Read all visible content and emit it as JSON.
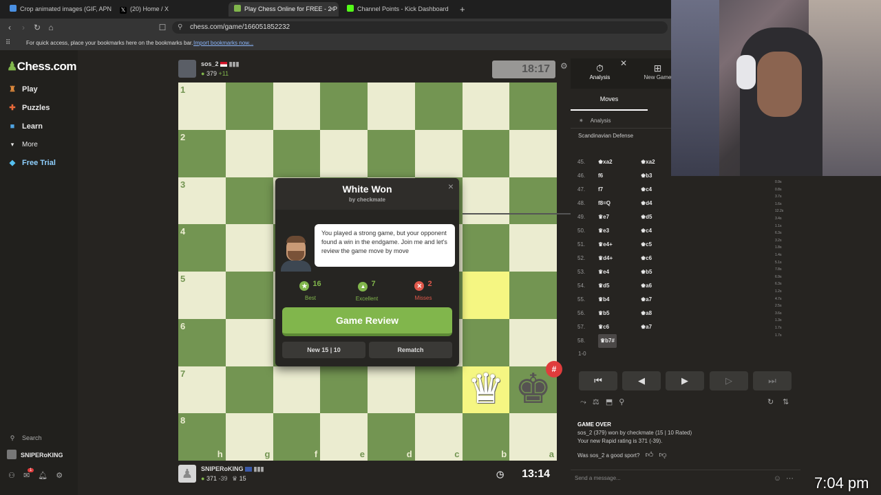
{
  "browser": {
    "tabs": [
      "Crop animated images (GIF, APNG, W",
      "(20) Home / X",
      "Play Chess Online for FREE - 2 P",
      "Channel Points - Kick Dashboard"
    ],
    "new_tab": "+",
    "url": "chess.com/game/166051852232",
    "bookmarks_msg": "For quick access, place your bookmarks here on the bookmarks bar.",
    "bookmarks_link": "Import bookmarks now..."
  },
  "sidebar": {
    "logo": "Chess.com",
    "items": [
      "Play",
      "Puzzles",
      "Learn",
      "More",
      "Free Trial"
    ],
    "search": "Search",
    "username": "SNIPERoKING",
    "notif_count": "1"
  },
  "top_player": {
    "name": "sos_2",
    "rating": "379",
    "rating_change": "+11",
    "clock": "18:17"
  },
  "bottom_player": {
    "name": "SNIPERoKING",
    "rating": "371",
    "rating_change": "-39",
    "score": "15",
    "clock": "13:14"
  },
  "board": {
    "ranks": [
      "1",
      "2",
      "3",
      "4",
      "5",
      "6",
      "7",
      "8"
    ],
    "files": [
      "h",
      "g",
      "f",
      "e",
      "d",
      "c",
      "b",
      "a"
    ],
    "pieces": {
      "white_queen": "♛",
      "black_king": "♚"
    },
    "check_badge": "#"
  },
  "modal": {
    "title": "White Won",
    "subtitle": "by checkmate",
    "message": "You played a strong game, but your opponent found a win in the endgame. Join me and let's review the game move by move",
    "stats": [
      {
        "value": "16",
        "label": "Best",
        "icon": "★",
        "color": "#81b64c"
      },
      {
        "value": "7",
        "label": "Excellent",
        "icon": "👍",
        "color": "#81b64c"
      },
      {
        "value": "2",
        "label": "Misses",
        "icon": "✕",
        "color": "#e0584b"
      }
    ],
    "review_button": "Game Review",
    "new_game_button": "New 15 | 10",
    "rematch_button": "Rematch",
    "close": "×"
  },
  "panel": {
    "tabs": [
      "Analysis",
      "New Game"
    ],
    "moves_tab": "Moves",
    "analysis_label": "Analysis",
    "opening": "Scandinavian Defense",
    "moves": [
      {
        "num": "45.",
        "white": "♚xa2",
        "black": "♚xa2"
      },
      {
        "num": "46.",
        "white": "f6",
        "black": "♚b3"
      },
      {
        "num": "47.",
        "white": "f7",
        "black": "♚c4"
      },
      {
        "num": "48.",
        "white": "f8=Q",
        "black": "♚d4"
      },
      {
        "num": "49.",
        "white": "♛e7",
        "black": "♚d5"
      },
      {
        "num": "50.",
        "white": "♛e3",
        "black": "♚c4"
      },
      {
        "num": "51.",
        "white": "♛e4+",
        "black": "♚c5"
      },
      {
        "num": "52.",
        "white": "♛d4+",
        "black": "♚c6"
      },
      {
        "num": "53.",
        "white": "♛e4",
        "black": "♚b5"
      },
      {
        "num": "54.",
        "white": "♛d5",
        "black": "♚a6"
      },
      {
        "num": "55.",
        "white": "♛b4",
        "black": "♚a7"
      },
      {
        "num": "56.",
        "white": "♛b5",
        "black": "♚a8"
      },
      {
        "num": "57.",
        "white": "♛c6",
        "black": "♚a7"
      },
      {
        "num": "58.",
        "white": "♛b7#",
        "black": ""
      }
    ],
    "times": [
      "0.9s",
      "0.8s",
      "3.7s",
      "1.6s",
      "12.2s",
      "3.4s",
      "1.1s",
      "6.3s",
      "3.2s",
      "1.8s",
      "1.4s",
      "5.1s",
      "7.8s",
      "6.9s",
      "6.3s",
      "1.2s",
      "4.7s",
      "2.5s",
      "3.6s",
      "1.3s",
      "1.7s",
      "1.7s"
    ],
    "result": "1-0",
    "controls": [
      "⏮",
      "◀",
      "▶",
      "▷",
      "⏭"
    ],
    "game_over_title": "GAME OVER",
    "game_over_line1": "sos_2 (379) won by checkmate (15 | 10 Rated)",
    "game_over_line2": "Your new Rapid rating is 371 (-39).",
    "good_sport": "Was sos_2 a good sport?",
    "chat_placeholder": "Send a message..."
  },
  "overlay_time": "7:04 pm"
}
